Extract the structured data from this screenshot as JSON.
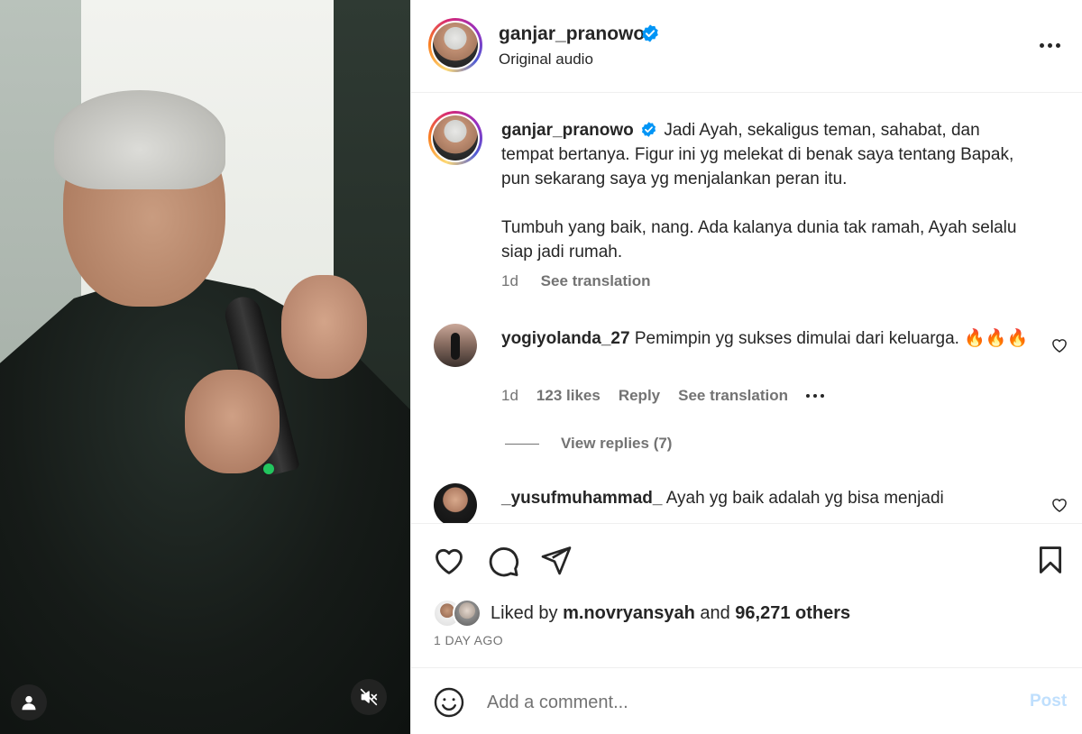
{
  "post": {
    "username": "ganjar_pranowo",
    "audio": "Original audio",
    "caption_username": "ganjar_pranowo",
    "caption_line1": "Jadi Ayah, sekaligus teman, sahabat, dan tempat bertanya. Figur ini yg melekat di benak saya tentang Bapak, pun sekarang saya yg menjalankan peran itu.",
    "caption_line2": "Tumbuh yang baik, nang. Ada kalanya dunia tak ramah, Ayah selalu siap jadi rumah.",
    "caption_age": "1d",
    "see_translation": "See translation"
  },
  "comments": [
    {
      "username": "yogiyolanda_27",
      "text": "Pemimpin yg sukses dimulai dari keluarga. 🔥🔥🔥",
      "age": "1d",
      "likes": "123 likes",
      "reply": "Reply",
      "see_translation": "See translation",
      "view_replies": "View replies (7)"
    },
    {
      "username": "_yusufmuhammad_",
      "text": "Ayah yg baik adalah yg bisa menjadi"
    }
  ],
  "liked_by": {
    "prefix": "Liked by",
    "user": "m.novryansyah",
    "and": "and",
    "others": "96,271 others"
  },
  "timestamp": "1 DAY AGO",
  "add_comment": {
    "placeholder": "Add a comment...",
    "post_label": "Post"
  },
  "colors": {
    "verified": "#0095f6",
    "post_disabled": "#bfdffd",
    "secondary_text": "#737373"
  },
  "icons": [
    "more-icon",
    "verified-icon",
    "heart-icon",
    "comment-icon",
    "share-icon",
    "bookmark-icon",
    "emoji-icon",
    "user-icon",
    "mute-icon"
  ]
}
